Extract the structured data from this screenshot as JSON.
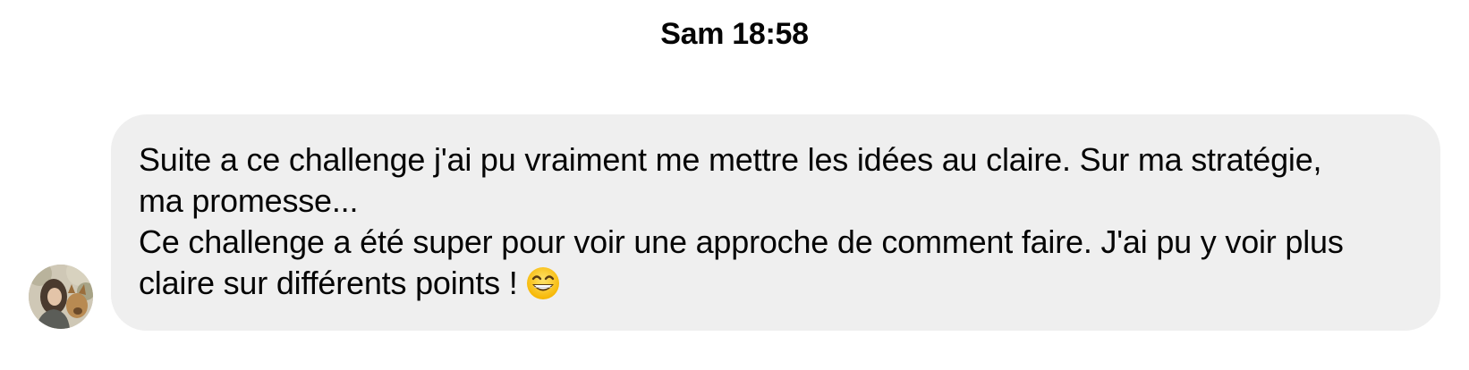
{
  "header": {
    "timestamp": "Sam 18:58"
  },
  "message": {
    "text": "Suite a ce challenge j'ai pu vraiment me mettre les idées au claire. Sur ma stratégie,\nma promesse...\nCe challenge a été super pour voir une approche de comment faire. J'ai pu y voir plus\nclaire sur différents points !",
    "emoji": "grinning-face-with-smiling-eyes",
    "bubble_color": "#efefef"
  },
  "sender": {
    "avatar_icon": "user-avatar-photo"
  }
}
